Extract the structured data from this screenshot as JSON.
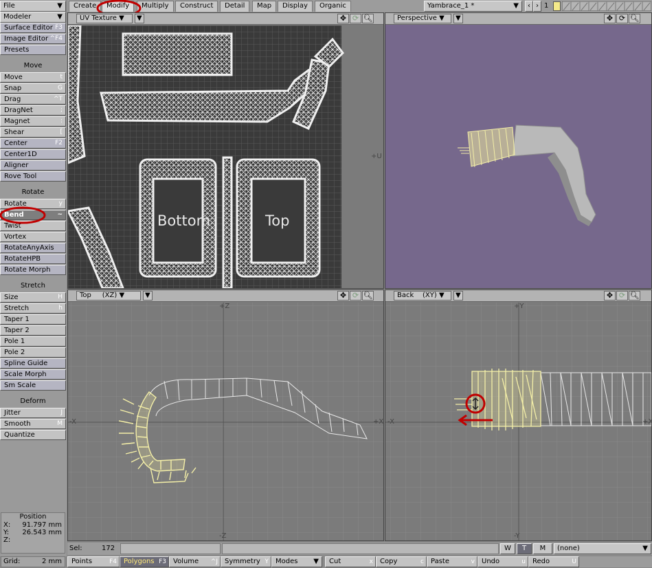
{
  "menu": {
    "file": "File",
    "modeler": "Modeler"
  },
  "tabs": [
    "Create",
    "Modify",
    "Multiply",
    "Construct",
    "Detail",
    "Map",
    "Display",
    "Organic"
  ],
  "object": {
    "name": "Yambrace_1  *",
    "layer": "1"
  },
  "sidebar": {
    "top": [
      {
        "label": "Surface Editor",
        "key": "F3"
      },
      {
        "label": "Image Editor",
        "key": "^F4"
      },
      {
        "label": "Presets",
        "key": ""
      }
    ],
    "groups": [
      {
        "title": "Move",
        "items": [
          {
            "label": "Move",
            "key": "t"
          },
          {
            "label": "Snap",
            "key": "G"
          },
          {
            "label": "Drag",
            "key": "^T"
          },
          {
            "label": "DragNet",
            "key": ";"
          },
          {
            "label": "Magnet",
            "key": ":"
          },
          {
            "label": "Shear",
            "key": "["
          },
          {
            "label": "Center",
            "key": "F2"
          },
          {
            "label": "Center1D",
            "key": ""
          },
          {
            "label": "Aligner",
            "key": ""
          },
          {
            "label": "Rove Tool",
            "key": ""
          }
        ]
      },
      {
        "title": "Rotate",
        "items": [
          {
            "label": "Rotate",
            "key": "y"
          },
          {
            "label": "Bend",
            "key": "~"
          },
          {
            "label": "Twist",
            "key": ""
          },
          {
            "label": "Vortex",
            "key": ""
          },
          {
            "label": "RotateAnyAxis",
            "key": ""
          },
          {
            "label": "RotateHPB",
            "key": ""
          },
          {
            "label": "Rotate Morph",
            "key": ""
          }
        ]
      },
      {
        "title": "Stretch",
        "items": [
          {
            "label": "Size",
            "key": "H"
          },
          {
            "label": "Stretch",
            "key": "h"
          },
          {
            "label": "Taper 1",
            "key": ""
          },
          {
            "label": "Taper 2",
            "key": ""
          },
          {
            "label": "Pole 1",
            "key": ""
          },
          {
            "label": "Pole 2",
            "key": ""
          },
          {
            "label": "Spline Guide",
            "key": ""
          },
          {
            "label": "Scale Morph",
            "key": ""
          },
          {
            "label": "Sm Scale",
            "key": ""
          }
        ]
      },
      {
        "title": "Deform",
        "items": [
          {
            "label": "Jitter",
            "key": "J"
          },
          {
            "label": "Smooth",
            "key": "M"
          },
          {
            "label": "Quantize",
            "key": ""
          }
        ]
      }
    ]
  },
  "position": {
    "title": "Position",
    "x": "91.797 mm",
    "y": "26.543 mm",
    "z": ""
  },
  "grid": {
    "label": "Grid:",
    "value": "2 mm"
  },
  "viewports": {
    "uv": {
      "label": "UV Texture",
      "axis_u": "+U",
      "text_bottom": "Bottom",
      "text_top": "Top"
    },
    "persp": {
      "label": "Perspective"
    },
    "top": {
      "label": "Top",
      "proj": "(XZ)",
      "axes": {
        "pz": "+Z",
        "nz": "-Z",
        "nx": "-X",
        "px": "+X"
      }
    },
    "back": {
      "label": "Back",
      "proj": "(XY)",
      "axes": {
        "py": "+Y",
        "ny": "-Y",
        "nx": "-X",
        "px": "+X"
      }
    }
  },
  "status": {
    "sel_label": "Sel:",
    "sel_value": "172",
    "wtm": [
      "W",
      "T",
      "M"
    ],
    "surface": "(none)"
  },
  "bottom": [
    {
      "label": "Points",
      "key": "F4"
    },
    {
      "label": "Polygons",
      "key": "F3"
    },
    {
      "label": "Volume",
      "key": "^J"
    },
    {
      "label": "Symmetry",
      "key": "Y"
    },
    {
      "label": "Modes",
      "key": ""
    },
    {
      "label": "Cut",
      "key": "x"
    },
    {
      "label": "Copy",
      "key": "c"
    },
    {
      "label": "Paste",
      "key": "v"
    },
    {
      "label": "Undo",
      "key": "u"
    },
    {
      "label": "Redo",
      "key": "U"
    }
  ],
  "colors": {
    "annotation": "#c00000",
    "selection": "#f5f0a8",
    "persp_bg": "#76688c"
  }
}
